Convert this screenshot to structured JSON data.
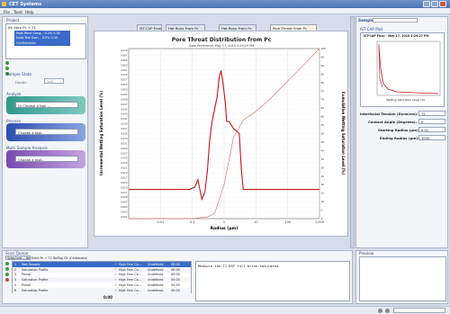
{
  "app": {
    "title": "CET Systems"
  },
  "menu": [
    "File",
    "Tools",
    "Help"
  ],
  "project": {
    "header": "Project",
    "root": "Jth Stlre Pc + T1",
    "items": [
      {
        "name": "High Rene Cong...",
        "v1": "0.2%",
        "v2": "0.35"
      },
      {
        "name": "Data Test Sam...",
        "v1": "0.5%",
        "v2": "0.45"
      },
      {
        "name": "Confirmation",
        "v1": "",
        "v2": ""
      }
    ]
  },
  "sample_state": {
    "header": "Sample State",
    "label": "Depth:",
    "value": "100"
  },
  "analysis": {
    "header": "Analyze",
    "placeholder": "(i) Choose a tool ..."
  },
  "process": {
    "header": "Process",
    "placeholder": "Choose a tool..."
  },
  "multi": {
    "header": "Multi Sample Analysis",
    "placeholder": "Choose a tool..."
  },
  "tabs": [
    "IST-CAP Final",
    "Hat Rono From Pc",
    "Hat Rono From Pc",
    "Pore Threat From Pc"
  ],
  "chart": {
    "title": "Pore Throat Distribution from Pc",
    "subtitle": "Date Performed: May 17, 2010 4:29:29 PM",
    "ylabel_left": "Incremental Wetting Saturation Level (%)",
    "ylabel_right": "Cumulative Wetting Saturation Level (%)",
    "xlabel": "Radius (µm)"
  },
  "chart_data": {
    "type": "line",
    "title": "Pore Throat Distribution from Pc",
    "xlabel": "Radius (µm)",
    "xscale": "log",
    "xlim": [
      0.001,
      1000
    ],
    "x_ticks": [
      "0.01",
      "0.1",
      "1",
      "10",
      "100",
      "1,000"
    ],
    "ylabel_left": "Incremental Wetting Saturation Level (%)",
    "ylim_left": [
      0,
      0.07
    ],
    "ylabel_right": "Cumulative Wetting Saturation Level (%)",
    "ylim_right": [
      0,
      100
    ],
    "y_ticks_left": [
      "0.070",
      "0.067",
      "0.065",
      "0.063",
      "0.061",
      "0.059",
      "0.057",
      "0.055",
      "0.053",
      "0.051",
      "0.049",
      "0.047",
      "0.045",
      "0.043",
      "0.041",
      "0.039",
      "0.037",
      "0.035",
      "0.033",
      "0.031",
      "0.029",
      "0.027",
      "0.025",
      "0.023",
      "0.021",
      "0.019",
      "0.017",
      "0.015",
      "0.013",
      "0.011",
      "0.009",
      "0.007",
      "0.005",
      "0.003",
      "0.001"
    ],
    "y_ticks_right": [
      "100",
      "95",
      "90",
      "85",
      "80",
      "75",
      "70",
      "65",
      "60",
      "55",
      "50",
      "45",
      "40",
      "35",
      "30",
      "25",
      "20",
      "15",
      "10",
      "5",
      "0"
    ],
    "series": [
      {
        "axis": "left",
        "color": "#c4161c",
        "x": [
          0.001,
          0.05,
          0.08,
          0.12,
          0.15,
          0.2,
          0.25,
          0.3,
          0.35,
          0.4,
          0.45,
          0.5,
          0.6,
          0.7,
          0.8,
          0.9,
          1.0,
          1.1,
          1.2,
          1.4,
          1.6,
          1.8,
          2.0,
          2.5,
          3.0,
          3.5,
          4.0,
          1000
        ],
        "y": [
          0.012,
          0.012,
          0.012,
          0.013,
          0.016,
          0.008,
          0.011,
          0.02,
          0.032,
          0.038,
          0.042,
          0.045,
          0.05,
          0.058,
          0.061,
          0.057,
          0.052,
          0.047,
          0.04,
          0.04,
          0.039,
          0.038,
          0.037,
          0.036,
          0.035,
          0.02,
          0.012,
          0.012
        ]
      },
      {
        "axis": "right",
        "color": "#d96060",
        "x": [
          0.001,
          0.1,
          0.3,
          0.5,
          1.0,
          2.0,
          4.0,
          10,
          30,
          100,
          300,
          1000
        ],
        "y": [
          0,
          0,
          1,
          3,
          20,
          48,
          58,
          63,
          71,
          81,
          90,
          100
        ]
      }
    ]
  },
  "right_panel": {
    "header": "Sample",
    "sub": "IST-CAP Plot",
    "thumb_title": "IST-CAP Final - May 17, 2010 4:29:27 PM",
    "thumb_xlabel": "Wetting Saturation Level (%)",
    "fields": [
      {
        "label": "Interfacial Tension (Dyne/cm):",
        "value": "72"
      },
      {
        "label": "Contact Angle (Degrees):",
        "value": "0"
      },
      {
        "label": "Starting Radius (µm):",
        "value": "0.01"
      },
      {
        "label": "Ending Radius (µm):",
        "value": "1000"
      }
    ]
  },
  "scan": {
    "header": "Scan Queue",
    "subheader": "ScanCard -- Jth Strlre Pc + T1 NoRug Cit (Carbonate)",
    "rows": [
      {
        "n": "1",
        "name": "Wet Sample",
        "type": "High Fern Ca...",
        "state": "Undefined",
        "time": "00:00"
      },
      {
        "n": "2",
        "name": "Saturation Profile",
        "type": "High Fern Ca...",
        "state": "Undefined",
        "time": "00:00"
      },
      {
        "n": "3",
        "name": "Pause",
        "type": "High Fern Ca...",
        "state": "Undefined",
        "time": "00:00"
      },
      {
        "n": "4",
        "name": "Saturation Profile",
        "type": "High Fern Ca...",
        "state": "Undefined",
        "time": "00:00"
      },
      {
        "n": "5",
        "name": "Pause",
        "type": "High Fern Ca...",
        "state": "Undefined",
        "time": "00:00"
      },
      {
        "n": "6",
        "name": "Saturation Profile",
        "type": "High Fern Ca...",
        "state": "Undefined",
        "time": "00:00"
      }
    ],
    "total": "0:00",
    "message": "Measure the T1 DSF full brine saturated.",
    "preview": "Preview"
  }
}
